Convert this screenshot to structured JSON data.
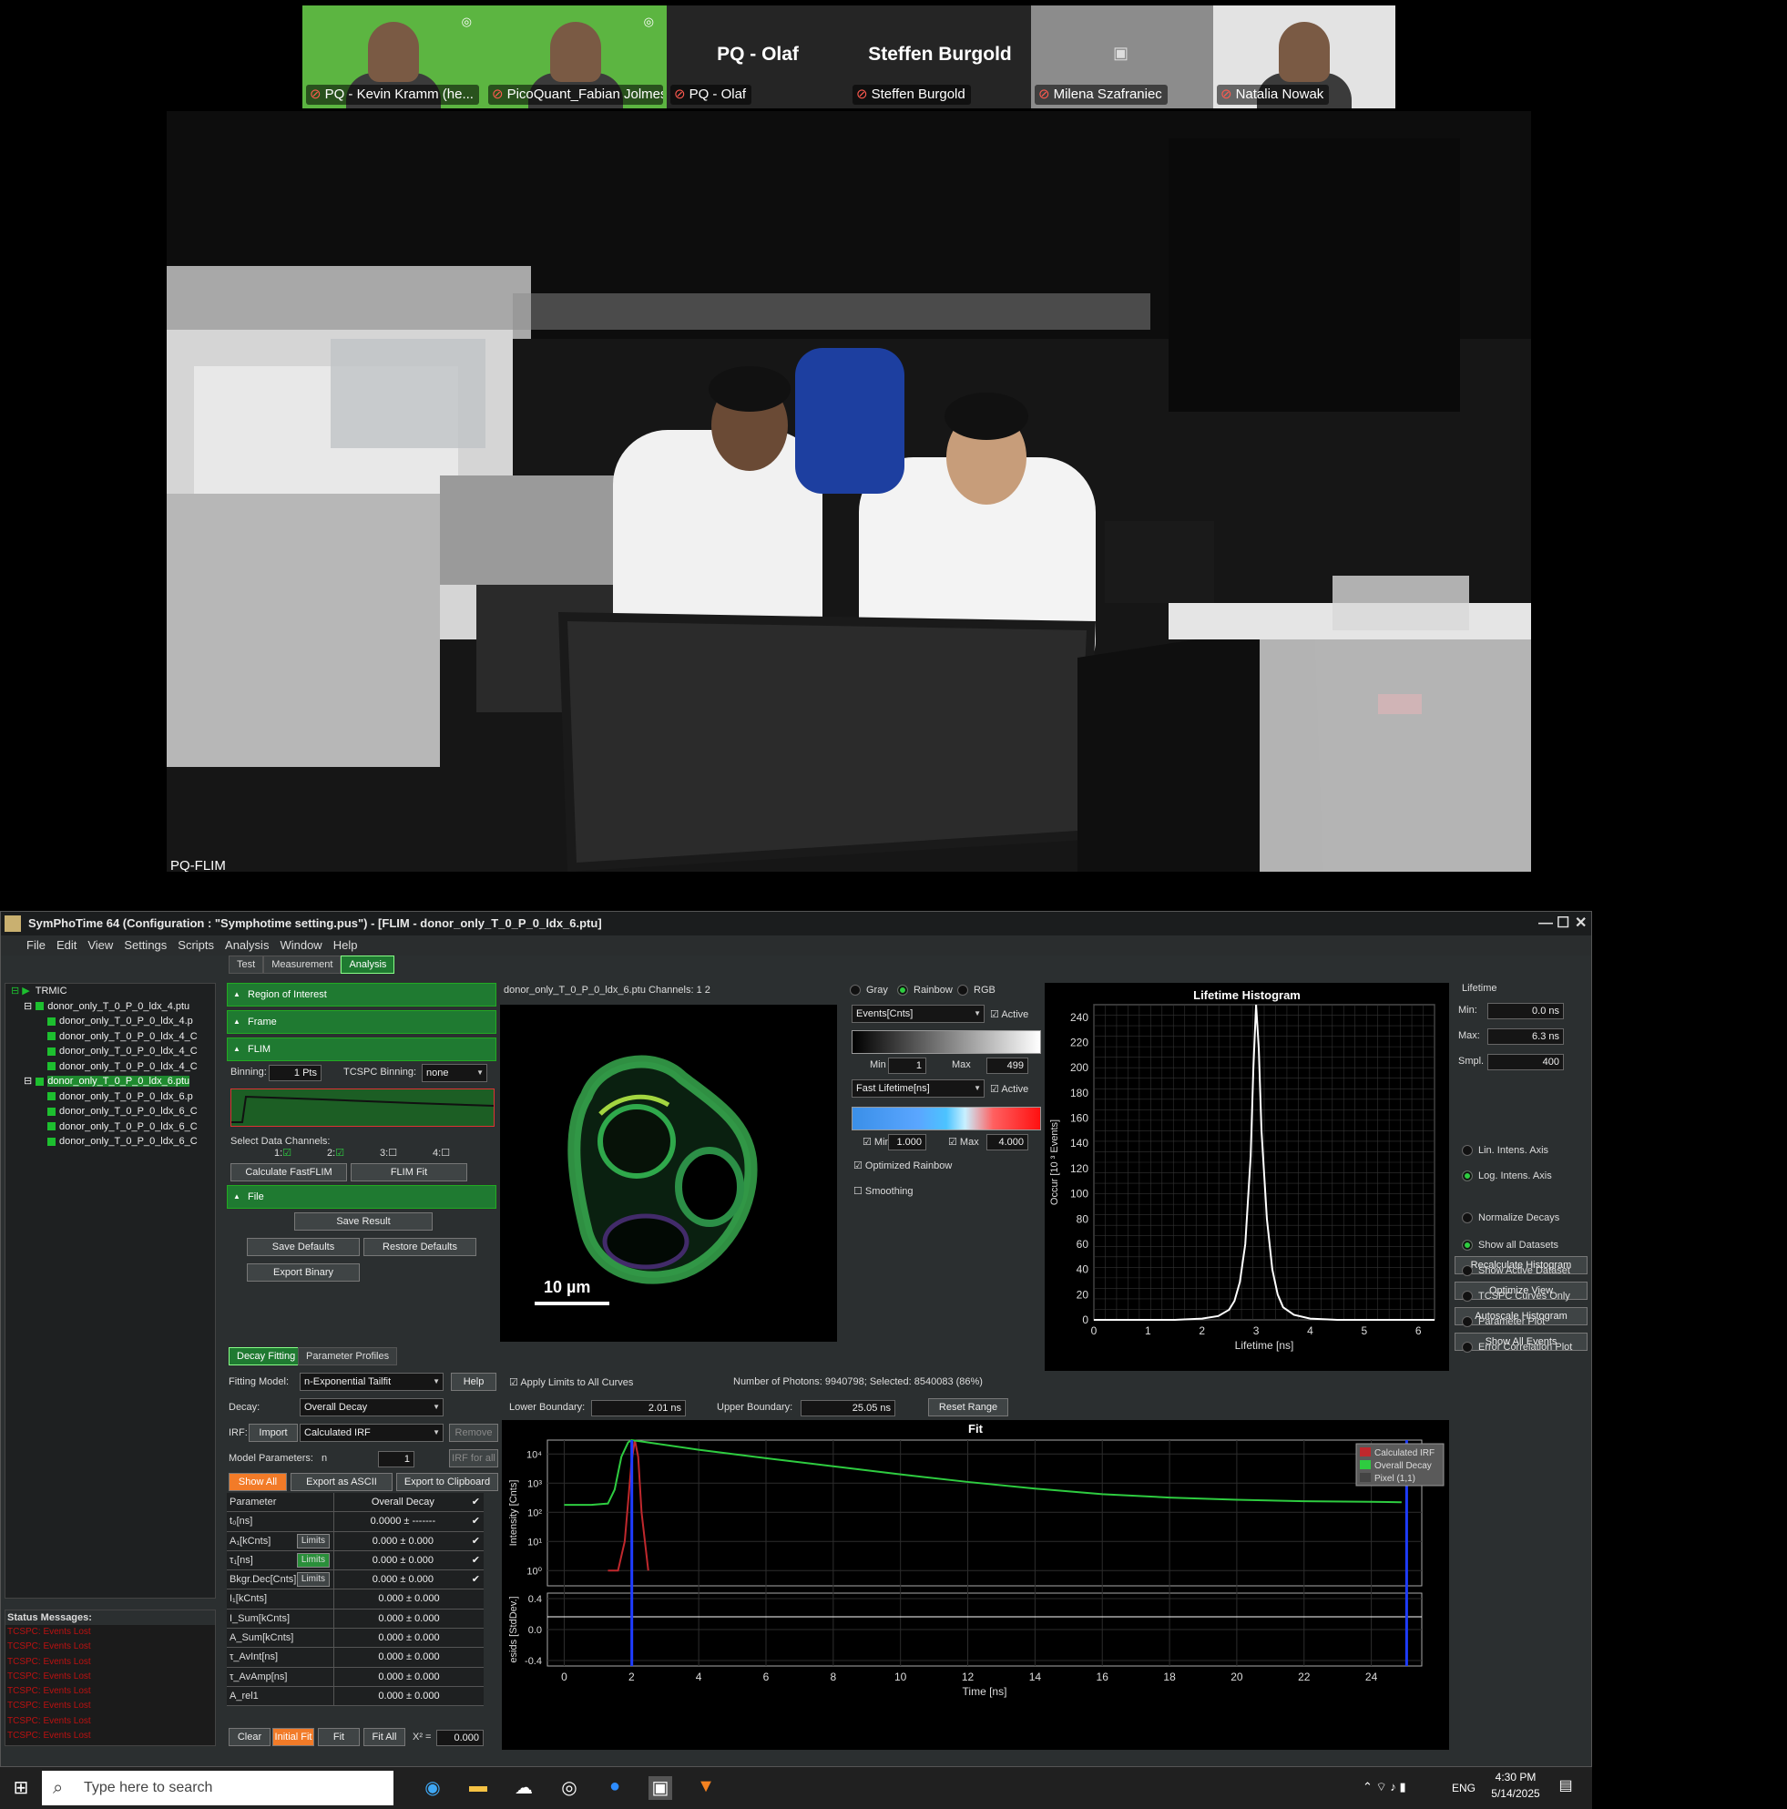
{
  "participants": [
    {
      "name": "PQ - Kevin Kramm (he...",
      "style": "green",
      "big": ""
    },
    {
      "name": "PicoQuant_Fabian Jolmes ...",
      "style": "green",
      "big": ""
    },
    {
      "name": "PQ - Olaf",
      "style": "dark",
      "big": "PQ - Olaf"
    },
    {
      "name": "Steffen Burgold",
      "style": "dark",
      "big": "Steffen Burgold"
    },
    {
      "name": "Milena Szafraniec",
      "style": "gray",
      "big": ""
    },
    {
      "name": "Natalia Nowak",
      "style": "white",
      "big": ""
    }
  ],
  "video": {
    "label": "PQ-FLIM"
  },
  "app": {
    "title": "SymPhoTime 64   (Configuration : \"Symphotime setting.pus\") - [FLIM - donor_only_T_0_P_0_ldx_6.ptu]",
    "menu": [
      "File",
      "Edit",
      "View",
      "Settings",
      "Scripts",
      "Analysis",
      "Window",
      "Help"
    ],
    "tabs": [
      "Test",
      "Measurement",
      "Analysis"
    ],
    "tree": {
      "root": "TRMIC",
      "items": [
        {
          "t": "donor_only_T_0_P_0_ldx_4.ptu",
          "lvl": 1,
          "sel": false
        },
        {
          "t": "donor_only_T_0_P_0_ldx_4.p",
          "lvl": 2,
          "sel": false
        },
        {
          "t": "donor_only_T_0_P_0_ldx_4_C",
          "lvl": 2,
          "sel": false
        },
        {
          "t": "donor_only_T_0_P_0_ldx_4_C",
          "lvl": 2,
          "sel": false
        },
        {
          "t": "donor_only_T_0_P_0_ldx_4_C",
          "lvl": 2,
          "sel": false
        },
        {
          "t": "donor_only_T_0_P_0_ldx_6.ptu",
          "lvl": 1,
          "sel": true
        },
        {
          "t": "donor_only_T_0_P_0_ldx_6.p",
          "lvl": 2,
          "sel": false
        },
        {
          "t": "donor_only_T_0_P_0_ldx_6_C",
          "lvl": 2,
          "sel": false
        },
        {
          "t": "donor_only_T_0_P_0_ldx_6_C",
          "lvl": 2,
          "sel": false
        },
        {
          "t": "donor_only_T_0_P_0_ldx_6_C",
          "lvl": 2,
          "sel": false
        }
      ]
    },
    "status": {
      "header": "Status Messages:",
      "msgs": [
        "TCSPC: Events Lost",
        "TCSPC: Events Lost",
        "TCSPC: Events Lost",
        "TCSPC: Events Lost",
        "TCSPC: Events Lost",
        "TCSPC: Events Lost",
        "TCSPC: Events Lost",
        "TCSPC: Events Lost"
      ]
    },
    "sections": {
      "roi": "Region of Interest",
      "frame": "Frame",
      "flim": "FLIM",
      "file": "File"
    },
    "flim": {
      "binning_label": "Binning:",
      "binning": "1 Pts",
      "tcspc_label": "TCSPC Binning:",
      "tcspc": "none",
      "channels_label": "Select Data Channels:",
      "ch": [
        "1:",
        "2:",
        "3:",
        "4:"
      ],
      "calc": "Calculate FastFLIM",
      "fit": "FLIM Fit"
    },
    "file": {
      "save": "Save Result",
      "defaults": "Save Defaults",
      "restore": "Restore Defaults",
      "export": "Export Binary"
    },
    "image": {
      "caption": "donor_only_T_0_P_0_ldx_6.ptu Channels: 1 2",
      "scale": "10 µm"
    },
    "color": {
      "gray": "Gray",
      "rainbow": "Rainbow",
      "rgb": "RGB",
      "events": "Events[Cnts]",
      "active": "Active",
      "min": "Min",
      "max": "Max",
      "ev_min": "1",
      "ev_max": "499",
      "fast": "Fast Lifetime[ns]",
      "fl_min": "1.000",
      "fl_max": "4.000",
      "opt": "Optimized Rainbow",
      "smooth": "Smoothing"
    },
    "lifetime": {
      "title": "Lifetime Histogram",
      "xlabel": "Lifetime [ns]",
      "ylabel": "Occur [10 ³ Events]",
      "panel": "Lifetime",
      "min_label": "Min:",
      "min": "0.0 ns",
      "max_label": "Max:",
      "max": "6.3 ns",
      "pts_label": "Smpl. Pts.:",
      "pts": "400",
      "btns": [
        "Recalculate Histogram",
        "Optimize View",
        "Autoscale Histogram",
        "Show All Events"
      ]
    },
    "fitting": {
      "tab1": "Decay Fitting",
      "tab2": "Parameter Profiles",
      "model_label": "Fitting Model:",
      "model": "n-Exponential Tailfit",
      "help": "Help",
      "decay_label": "Decay:",
      "decay": "Overall Decay",
      "irf_label": "IRF:",
      "import": "Import",
      "irf": "Calculated IRF",
      "remove": "Remove",
      "mp_label": "Model Parameters:",
      "mp_n": "n",
      "mp_val": "1",
      "irf_all": "IRF for all",
      "show_all": "Show All",
      "export_ascii": "Export as ASCII",
      "export_clip": "Export to Clipboard",
      "apply": "Apply Limits to All Curves",
      "photons": "Number of Photons: 9940798; Selected: 8540083 (86%)",
      "lower_label": "Lower Boundary:",
      "lower": "2.01 ns",
      "upper_label": "Upper Boundary:",
      "upper": "25.05 ns",
      "reset": "Reset Range",
      "clear": "Clear",
      "initial": "Initial Fit",
      "fit": "Fit",
      "fitall": "Fit All",
      "chi": "X² =",
      "chi_val": "0.000",
      "limits": "Limits"
    },
    "params": [
      {
        "name": "Parameter",
        "val": "Overall Decay",
        "limit": ""
      },
      {
        "name": "t₀[ns]",
        "val": "0.0000 ± -------",
        "limit": ""
      },
      {
        "name": "A₁[kCnts]",
        "val": "0.000 ± 0.000",
        "limit": "off"
      },
      {
        "name": "τ₁[ns]",
        "val": "0.000 ± 0.000",
        "limit": "on"
      },
      {
        "name": "Bkgr.Dec[Cnts]",
        "val": "0.000 ± 0.000",
        "limit": "off"
      },
      {
        "name": "I₁[kCnts]",
        "val": "0.000 ± 0.000",
        "limit": ""
      },
      {
        "name": "I_Sum[kCnts]",
        "val": "0.000 ± 0.000",
        "limit": ""
      },
      {
        "name": "A_Sum[kCnts]",
        "val": "0.000 ± 0.000",
        "limit": ""
      },
      {
        "name": "τ_AvInt[ns]",
        "val": "0.000 ± 0.000",
        "limit": ""
      },
      {
        "name": "τ_AvAmp[ns]",
        "val": "0.000 ± 0.000",
        "limit": ""
      },
      {
        "name": "A_rel1",
        "val": "0.000 ± 0.000",
        "limit": ""
      }
    ],
    "fitplot": {
      "title": "Fit",
      "ylabel": "Intensity [Cnts]",
      "reslabel": "esids [StdDev.]",
      "xlabel": "Time [ns]",
      "legend": [
        "Calculated IRF",
        "Overall Decay",
        "Pixel (1,1)"
      ]
    },
    "options": [
      {
        "t": "Lin. Intens. Axis",
        "on": false
      },
      {
        "t": "Log. Intens. Axis",
        "on": true
      },
      {
        "t": "Normalize Decays",
        "on": false
      },
      {
        "t": "Show all Datasets",
        "on": true
      },
      {
        "t": "Show Active Dataset",
        "on": false
      },
      {
        "t": "TCSPC Curves Only",
        "on": false
      },
      {
        "t": "Parameter Plot",
        "on": false
      },
      {
        "t": "Error Correlation Plot",
        "on": false
      }
    ]
  },
  "taskbar": {
    "search": "Type here to search",
    "lang": "ENG",
    "time": "4:30 PM",
    "date": "5/14/2025"
  },
  "chart_data": [
    {
      "type": "line",
      "title": "Lifetime Histogram",
      "xlabel": "Lifetime [ns]",
      "ylabel": "Occur [10 ³ Events]",
      "xlim": [
        0,
        6.3
      ],
      "ylim": [
        0,
        250
      ],
      "xticks": [
        0,
        1,
        2,
        3,
        4,
        5,
        6
      ],
      "yticks": [
        0,
        20,
        40,
        60,
        80,
        100,
        120,
        140,
        160,
        180,
        200,
        220,
        240
      ],
      "x": [
        0,
        1.5,
        2.0,
        2.3,
        2.5,
        2.6,
        2.7,
        2.8,
        2.9,
        2.95,
        3.0,
        3.05,
        3.1,
        3.2,
        3.3,
        3.4,
        3.5,
        3.7,
        4.0,
        4.5,
        6.3
      ],
      "values": [
        0,
        0,
        1,
        3,
        8,
        15,
        30,
        60,
        130,
        200,
        250,
        215,
        150,
        80,
        40,
        20,
        10,
        4,
        1,
        0,
        0
      ],
      "grid": true
    },
    {
      "type": "line",
      "title": "Fit",
      "xlabel": "Time [ns]",
      "ylabel": "Intensity [Cnts]",
      "yscale": "log",
      "xlim": [
        -0.5,
        25.5
      ],
      "ylim": [
        0.3,
        30000
      ],
      "xticks": [
        0,
        2,
        4,
        6,
        8,
        10,
        12,
        14,
        16,
        18,
        20,
        22,
        24
      ],
      "yticks": [
        "10⁰",
        "10¹",
        "10²",
        "10³",
        "10⁴"
      ],
      "series": [
        {
          "name": "Overall Decay",
          "color": "#2ecc40",
          "x": [
            0,
            0.8,
            1.3,
            1.5,
            1.7,
            1.9,
            2.0,
            2.2,
            4,
            6,
            8,
            10,
            12,
            14,
            16,
            18,
            20,
            22,
            24,
            24.9
          ],
          "values": [
            180,
            180,
            200,
            600,
            8000,
            25000,
            30000,
            28000,
            14000,
            7200,
            3800,
            2000,
            1100,
            650,
            420,
            320,
            270,
            240,
            230,
            220
          ]
        },
        {
          "name": "Calculated IRF",
          "color": "#c0282d",
          "x": [
            1.3,
            1.6,
            1.8,
            2.0,
            2.1,
            2.2,
            2.3,
            2.5
          ],
          "values": [
            1,
            1,
            10,
            5000,
            30000,
            8000,
            100,
            1
          ]
        }
      ],
      "residual_ylim": [
        -0.4,
        0.4
      ],
      "residual_yticks": [
        -0.4,
        0.0,
        0.4
      ],
      "boundaries": [
        2.01,
        25.05
      ],
      "grid": true
    }
  ]
}
